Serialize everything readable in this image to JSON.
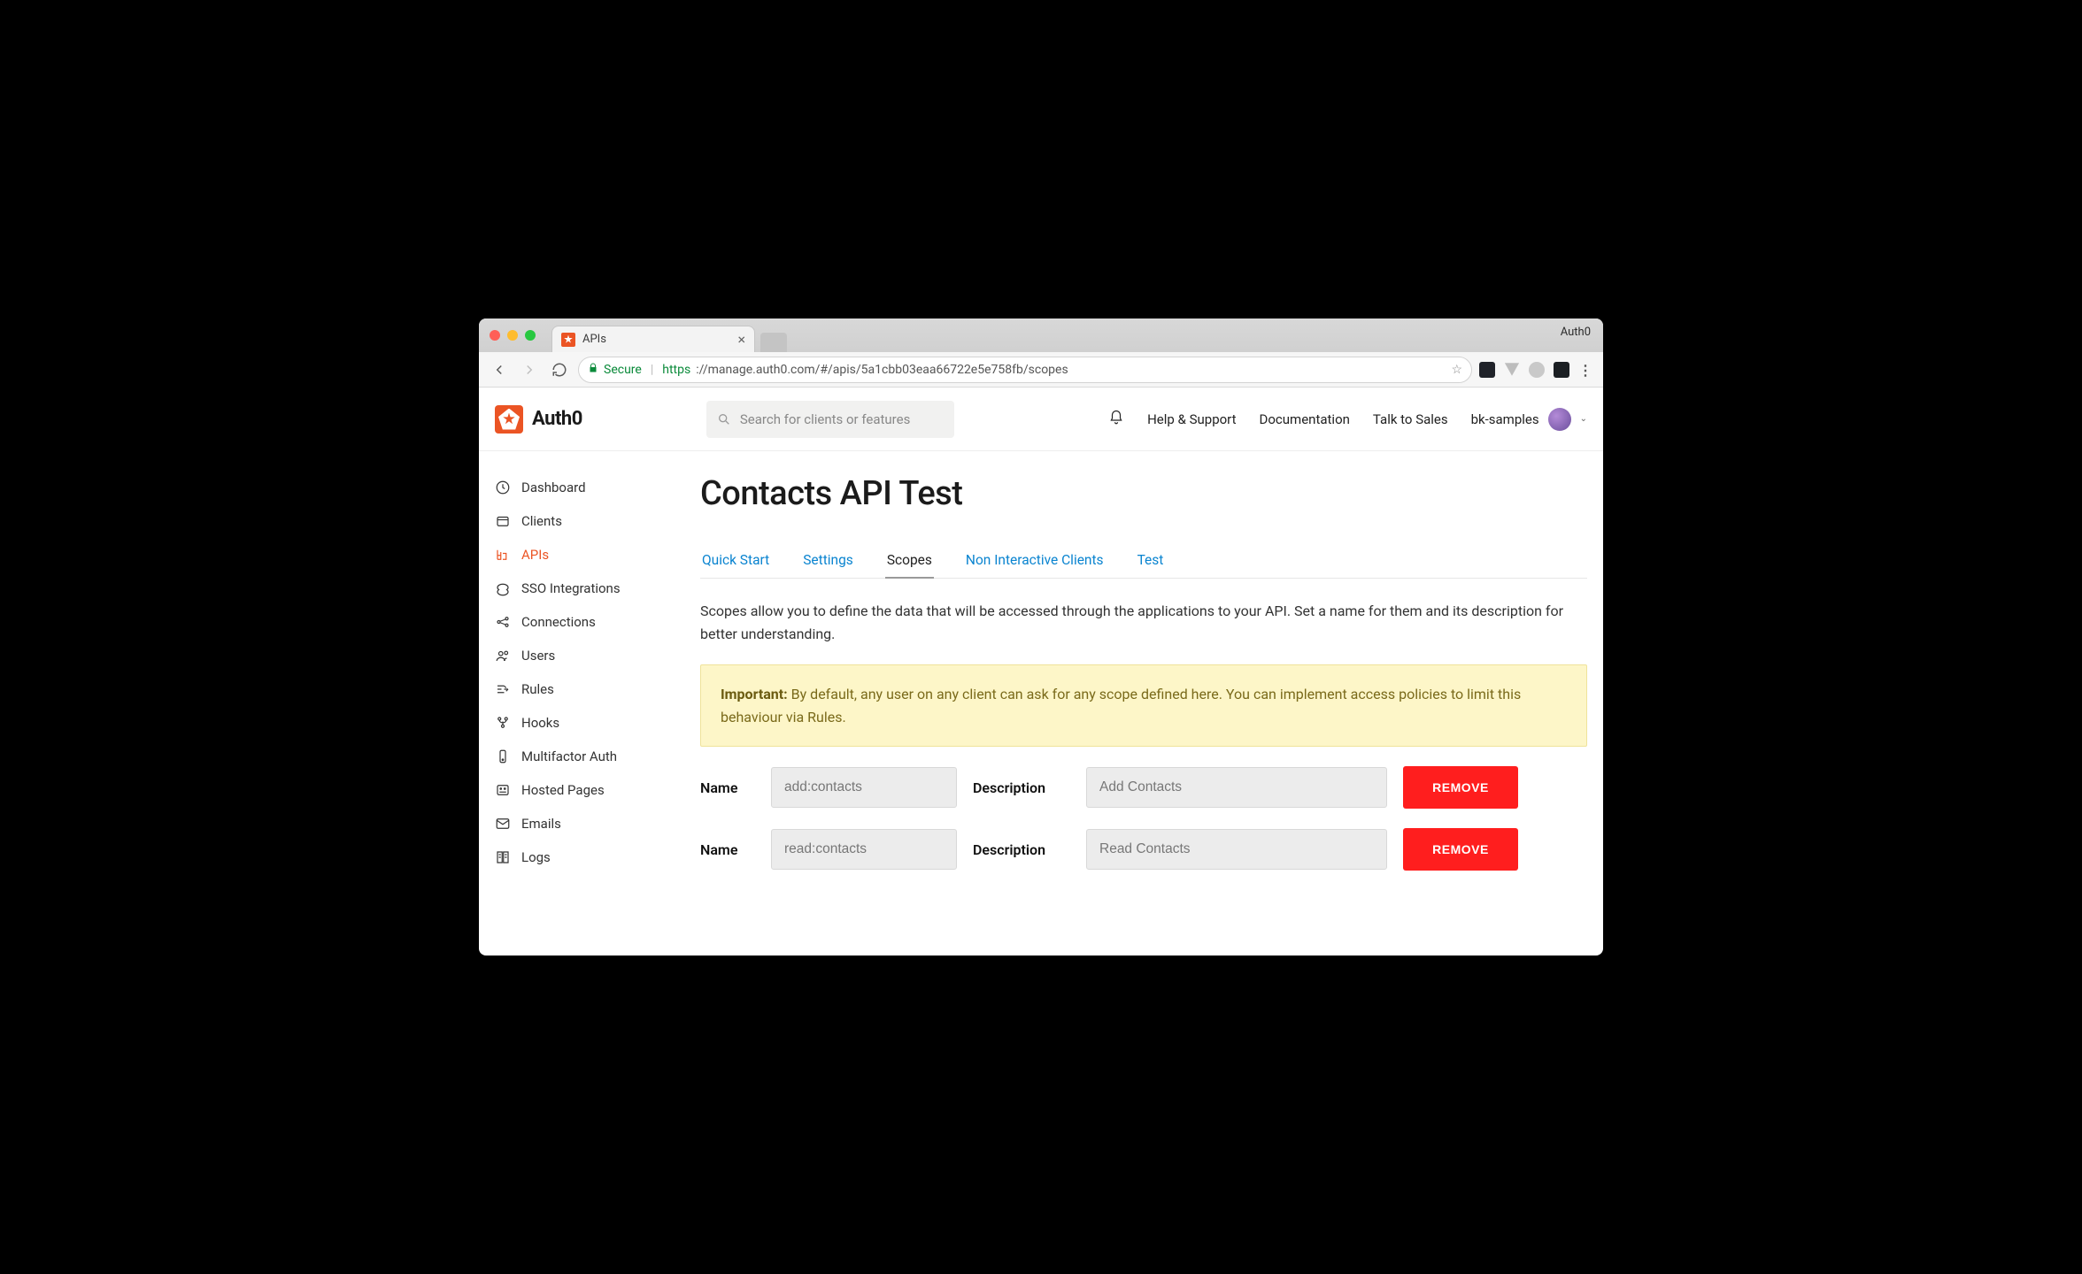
{
  "browser": {
    "app_label": "Auth0",
    "tab_title": "APIs",
    "secure_label": "Secure",
    "url_proto": "https",
    "url_rest": "://manage.auth0.com/#/apis/5a1cbb03eaa66722e5e758fb/scopes"
  },
  "header": {
    "brand": "Auth0",
    "search_placeholder": "Search for clients or features",
    "links": {
      "help": "Help & Support",
      "docs": "Documentation",
      "sales": "Talk to Sales"
    },
    "username": "bk-samples"
  },
  "sidebar": {
    "items": [
      {
        "label": "Dashboard"
      },
      {
        "label": "Clients"
      },
      {
        "label": "APIs"
      },
      {
        "label": "SSO Integrations"
      },
      {
        "label": "Connections"
      },
      {
        "label": "Users"
      },
      {
        "label": "Rules"
      },
      {
        "label": "Hooks"
      },
      {
        "label": "Multifactor Auth"
      },
      {
        "label": "Hosted Pages"
      },
      {
        "label": "Emails"
      },
      {
        "label": "Logs"
      }
    ],
    "active_index": 2
  },
  "page": {
    "title": "Contacts API Test",
    "tabs": [
      "Quick Start",
      "Settings",
      "Scopes",
      "Non Interactive Clients",
      "Test"
    ],
    "active_tab_index": 2,
    "description": "Scopes allow you to define the data that will be accessed through the applications to your API. Set a name for them and its description for better understanding.",
    "alert_prefix": "Important:",
    "alert_body": " By default, any user on any client can ask for any scope defined here. You can implement access policies to limit this behaviour via Rules.",
    "field_name_label": "Name",
    "field_desc_label": "Description",
    "remove_label": "REMOVE",
    "scopes": [
      {
        "name": "add:contacts",
        "desc": "Add Contacts"
      },
      {
        "name": "read:contacts",
        "desc": "Read Contacts"
      }
    ]
  }
}
